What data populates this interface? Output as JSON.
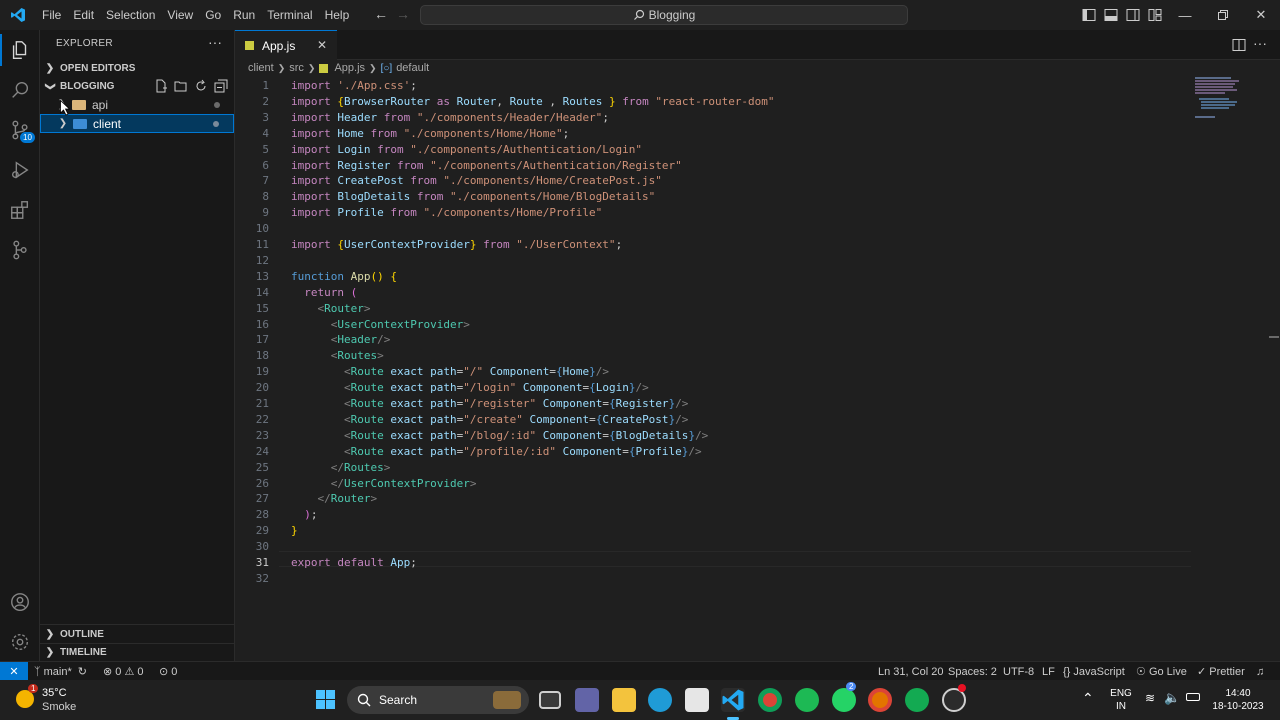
{
  "menu": [
    "File",
    "Edit",
    "Selection",
    "View",
    "Go",
    "Run",
    "Terminal",
    "Help"
  ],
  "search": {
    "label": "Blogging"
  },
  "sidebar": {
    "title": "EXPLORER",
    "open_editors": "OPEN EDITORS",
    "workspace": "BLOGGING",
    "folders": [
      {
        "label": "api",
        "color": "#dcb67a"
      },
      {
        "label": "client",
        "color": "#3c8dd6"
      }
    ],
    "outline": "OUTLINE",
    "timeline": "TIMELINE"
  },
  "tab": {
    "label": "App.js"
  },
  "breadcrumb": {
    "a": "client",
    "b": "src",
    "c": "App.js",
    "d": "default"
  },
  "code": {
    "l1_from": "import",
    "l1_str": "'./App.css'",
    "l1_end": ";",
    "l2_imp": "import",
    "l2_b1": "{",
    "l2_v1": "BrowserRouter",
    "l2_as": " as ",
    "l2_v2": "Router",
    "l2_c1": ", ",
    "l2_v3": "Route",
    "l2_c2": " , ",
    "l2_v4": "Routes",
    "l2_b2": " }",
    "l2_from": " from ",
    "l2_str": "\"react-router-dom\"",
    "imports": [
      {
        "name": "Header",
        "src": "\"./components/Header/Header\"",
        "end": ";"
      },
      {
        "name": "Home",
        "src": "\"./components/Home/Home\"",
        "end": ";"
      },
      {
        "name": "Login",
        "src": "\"./components/Authentication/Login\"",
        "end": ""
      },
      {
        "name": "Register",
        "src": "\"./components/Authentication/Register\"",
        "end": ""
      },
      {
        "name": "CreatePost",
        "src": "\"./components/Home/CreatePost.js\"",
        "end": ""
      },
      {
        "name": "BlogDetails",
        "src": "\"./components/Home/BlogDetails\"",
        "end": ""
      },
      {
        "name": "Profile",
        "src": "\"./components/Home/Profile\"",
        "end": ""
      }
    ],
    "kw_import": "import",
    "kw_from": "from",
    "l11_name": "UserContextProvider",
    "l11_src": "\"./UserContext\"",
    "kw_function": "function",
    "fn_name": "App",
    "kw_return": "return",
    "tag_router": "Router",
    "tag_ucp": "UserContextProvider",
    "tag_header": "Header",
    "tag_routes": "Routes",
    "tag_route": "Route",
    "attr_exact": "exact",
    "attr_path": "path",
    "attr_component": "Component",
    "routes": [
      {
        "path": "\"/\"",
        "comp": "Home"
      },
      {
        "path": "\"/login\"",
        "comp": "Login"
      },
      {
        "path": "\"/register\"",
        "comp": "Register"
      },
      {
        "path": "\"/create\"",
        "comp": "CreatePost"
      },
      {
        "path": "\"/blog/:id\"",
        "comp": "BlogDetails"
      },
      {
        "path": "\"/profile/:id\"",
        "comp": "Profile"
      }
    ],
    "kw_export": "export",
    "kw_default": "default",
    "export_name": "App"
  },
  "status": {
    "branch": "main*",
    "errors": "0",
    "warnings": "0",
    "ports": "0",
    "position": "Ln 31, Col 20",
    "spaces": "Spaces: 2",
    "encoding": "UTF-8",
    "eol": "LF",
    "language": "JavaScript",
    "golive": "Go Live",
    "prettier": "Prettier"
  },
  "taskbar": {
    "temp": "35°C",
    "weather": "Smoke",
    "weather_badge": "1",
    "search": "Search",
    "lang1": "ENG",
    "lang2": "IN",
    "time": "14:40",
    "date": "18-10-2023",
    "teams_badge": "2"
  },
  "icons": {
    "activity": [
      "explorer-icon",
      "search-icon",
      "source-control-icon",
      "run-debug-icon",
      "extensions-icon",
      "git-graph-icon",
      "account-icon",
      "settings-gear-icon"
    ],
    "scm_badge": "10"
  }
}
